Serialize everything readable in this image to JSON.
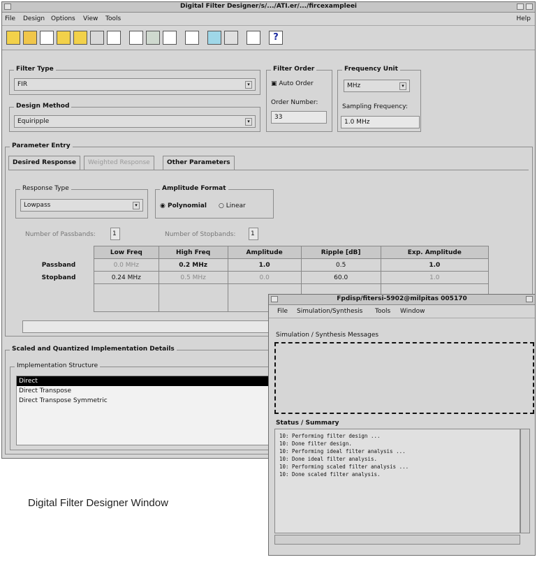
{
  "main_window": {
    "title": "Digital Filter Designer/s/.../ATI.er/.../fircexampleei",
    "menu": [
      "File",
      "Design",
      "Options",
      "View",
      "Tools"
    ],
    "help": "Help",
    "toolbar_icons": [
      "new-icon",
      "open-icon",
      "blank-icon",
      "folder-icon",
      "save-icon",
      "print-icon",
      "plot-icon",
      "wave-icon",
      "grid-icon",
      "curve-icon",
      "zoom-icon",
      "dither-icon",
      "matrix-icon",
      "freq-icon",
      "help-icon"
    ],
    "filter_type": {
      "label": "Filter Type",
      "value": "FIR"
    },
    "design_method": {
      "label": "Design Method",
      "value": "Equiripple"
    },
    "filter_order": {
      "label": "Filter Order",
      "auto_order": "Auto Order",
      "order_number_label": "Order Number:",
      "order_number_value": "33"
    },
    "frequency_unit": {
      "label": "Frequency Unit",
      "value": "MHz",
      "sampling_label": "Sampling Frequency:",
      "sampling_value": "1.0 MHz"
    },
    "parameter_entry": {
      "label": "Parameter Entry",
      "tabs": [
        "Desired Response",
        "Weighted Response",
        "Other Parameters"
      ],
      "response_type": {
        "label": "Response Type",
        "value": "Lowpass"
      },
      "amplitude_format": {
        "label": "Amplitude Format",
        "options": [
          "Polynomial",
          "Linear"
        ]
      },
      "passbands_label": "Number of Passbands:",
      "passbands_value": "1",
      "stopbands_label": "Number of Stopbands:",
      "stopbands_value": "1",
      "table": {
        "headers": [
          "",
          "Low Freq",
          "High Freq",
          "Amplitude",
          "Ripple [dB]",
          "Exp. Amplitude"
        ],
        "rows": [
          [
            "Passband",
            "0.0 MHz",
            "0.2 MHz",
            "1.0",
            "0.5",
            "1.0"
          ],
          [
            "Stopband",
            "0.24 MHz",
            "0.5 MHz",
            "0.0",
            "60.0",
            "1.0"
          ]
        ]
      }
    },
    "implementation": {
      "label": "Scaled and Quantized Implementation Details",
      "structure_label": "Implementation Structure",
      "items": [
        "Direct",
        "Direct Transpose",
        "Direct Transpose Symmetric"
      ]
    }
  },
  "second_window": {
    "title": "Fpdisp/fitersi-5902@milpitas 005170",
    "menu": [
      "File",
      "Simulation/Synthesis",
      "Tools",
      "Window"
    ],
    "label": "Simulation / Synthesis Messages",
    "status_label": "Status / Summary",
    "status_lines": [
      "10: Performing filter design ...",
      "10: Done filter design.",
      "10: Performing ideal filter analysis ...",
      "10: Done ideal filter analysis.",
      "10: Performing scaled filter analysis ...",
      "10: Done scaled filter analysis."
    ]
  },
  "caption": "Digital Filter Designer Window"
}
